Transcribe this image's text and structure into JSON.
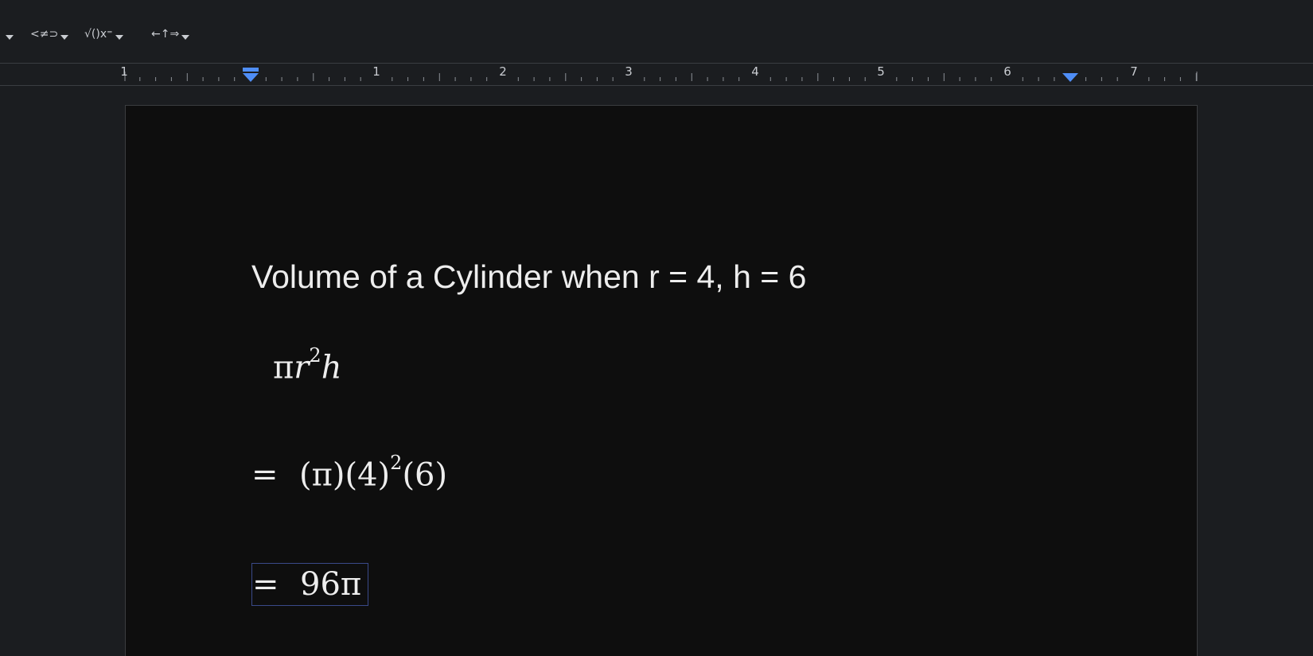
{
  "toolbar": {
    "groups": [
      {
        "label": "",
        "icon": "dropdown-caret"
      },
      {
        "label": "<≠⊃",
        "icon": "relations-symbols"
      },
      {
        "label": "√()x⁼",
        "icon": "math-operators"
      },
      {
        "label": "←↑⇒",
        "icon": "arrows-symbols"
      }
    ]
  },
  "ruler": {
    "labels": [
      "1",
      "1",
      "2",
      "3",
      "4",
      "5",
      "6",
      "7"
    ],
    "accent": "#4f8ef7"
  },
  "document": {
    "title": "Volume of a Cylinder when r = 4, h = 6",
    "eq1": {
      "pi": "π",
      "r": "r",
      "exp": "2",
      "h": "h"
    },
    "eq2": {
      "eq": "=",
      "pi_group": "(π)",
      "four_group": "(4)",
      "exp": "2",
      "six_group": "(6)"
    },
    "eq3": {
      "eq": "=",
      "result": "96π"
    }
  }
}
